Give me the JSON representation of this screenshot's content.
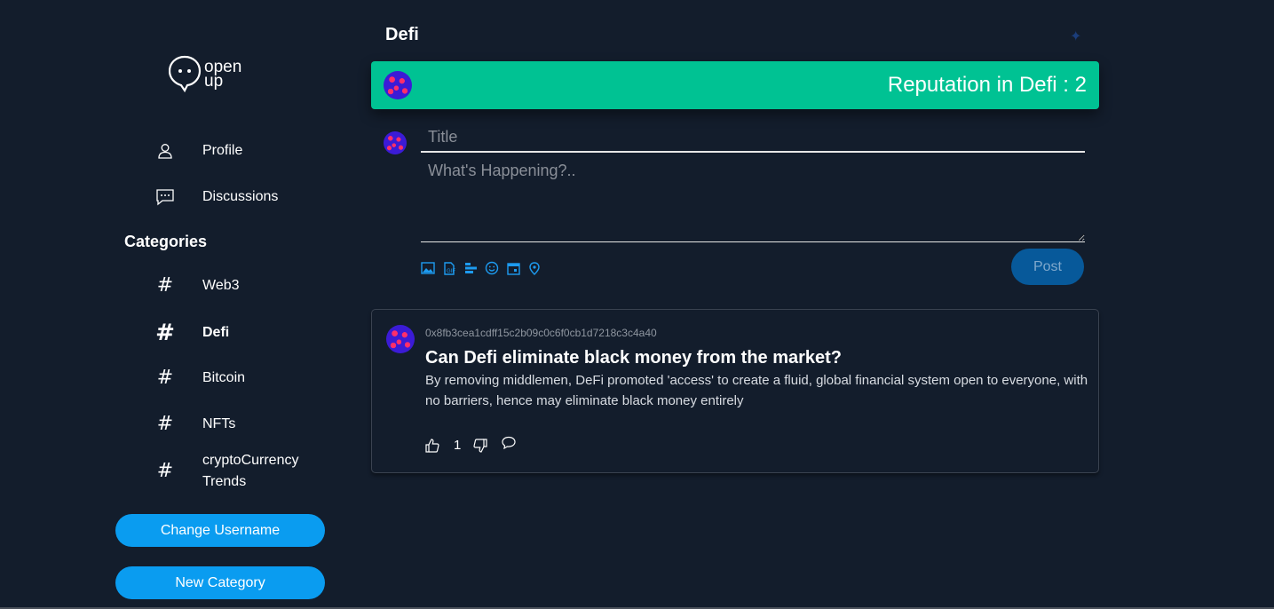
{
  "sidebar": {
    "logo_text": "open up",
    "nav": [
      {
        "label": "Profile",
        "icon": "user-icon"
      },
      {
        "label": "Discussions",
        "icon": "chat-icon"
      }
    ],
    "categories_heading": "Categories",
    "categories": [
      {
        "label": "Web3",
        "active": false
      },
      {
        "label": "Defi",
        "active": true
      },
      {
        "label": "Bitcoin",
        "active": false
      },
      {
        "label": "NFTs",
        "active": false
      },
      {
        "label": "cryptoCurrency Trends",
        "active": false
      }
    ],
    "change_username_label": "Change Username",
    "new_category_label": "New Category"
  },
  "header": {
    "title": "Defi"
  },
  "reputation": {
    "text": "Reputation in Defi : 2",
    "color": "#00c293"
  },
  "composer": {
    "title_placeholder": "Title",
    "body_placeholder": "What's Happening?..",
    "post_label": "Post",
    "tools": [
      "image-icon",
      "file-icon",
      "poll-icon",
      "emoji-icon",
      "calendar-icon",
      "location-icon"
    ]
  },
  "posts": [
    {
      "author": "0x8fb3cea1cdff15c2b09c0c6f0cb1d7218c3c4a40",
      "title": "Can Defi eliminate black money from the market?",
      "body": "By removing middlemen, DeFi promoted 'access' to create a fluid, global financial system open to everyone, with no barriers, hence may eliminate black money entirely",
      "likes": "1"
    }
  ],
  "colors": {
    "background": "#131d2c",
    "accent": "#0a9cf0",
    "reputation": "#00c293",
    "post_button": "#07599a"
  }
}
